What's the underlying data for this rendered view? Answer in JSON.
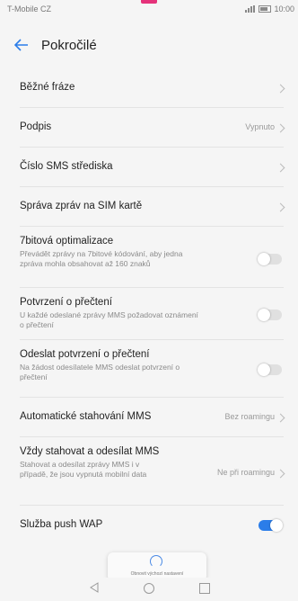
{
  "status": {
    "carrier": "T-Mobile CZ",
    "time": "10:00"
  },
  "header": {
    "title": "Pokročilé"
  },
  "rows": {
    "phrases": {
      "label": "Běžné fráze"
    },
    "signature": {
      "label": "Podpis",
      "value": "Vypnuto"
    },
    "smsc": {
      "label": "Číslo SMS střediska"
    },
    "sim": {
      "label": "Správa zpráv na SIM kartě"
    },
    "seven_bit": {
      "label": "7bitová optimalizace",
      "desc": "Převádět zprávy na 7bitové kódování, aby jedna zpráva mohla obsahovat až 160 znaků",
      "on": false
    },
    "read_receipt": {
      "label": "Potvrzení o přečtení",
      "desc": "U každé odeslané zprávy MMS požadovat oznámení o přečtení",
      "on": false
    },
    "send_receipt": {
      "label": "Odeslat potvrzení o přečtení",
      "desc": "Na žádost odesílatele MMS odeslat potvrzení o přečtení",
      "on": false
    },
    "auto_mms": {
      "label": "Automatické stahování MMS",
      "value": "Bez roamingu"
    },
    "always_mms": {
      "label": "Vždy stahovat a odesílat MMS",
      "desc": "Stahovat a odesílat zprávy MMS i v případě, že jsou vypnutá mobilní data",
      "value": "Ne při roamingu"
    },
    "push": {
      "label": "Služba push WAP",
      "on": true
    }
  },
  "toast": {
    "message": "Obnovit výchozí nastavení"
  },
  "colors": {
    "accent": "#2b7de9",
    "brand_pink": "#e5327a"
  }
}
